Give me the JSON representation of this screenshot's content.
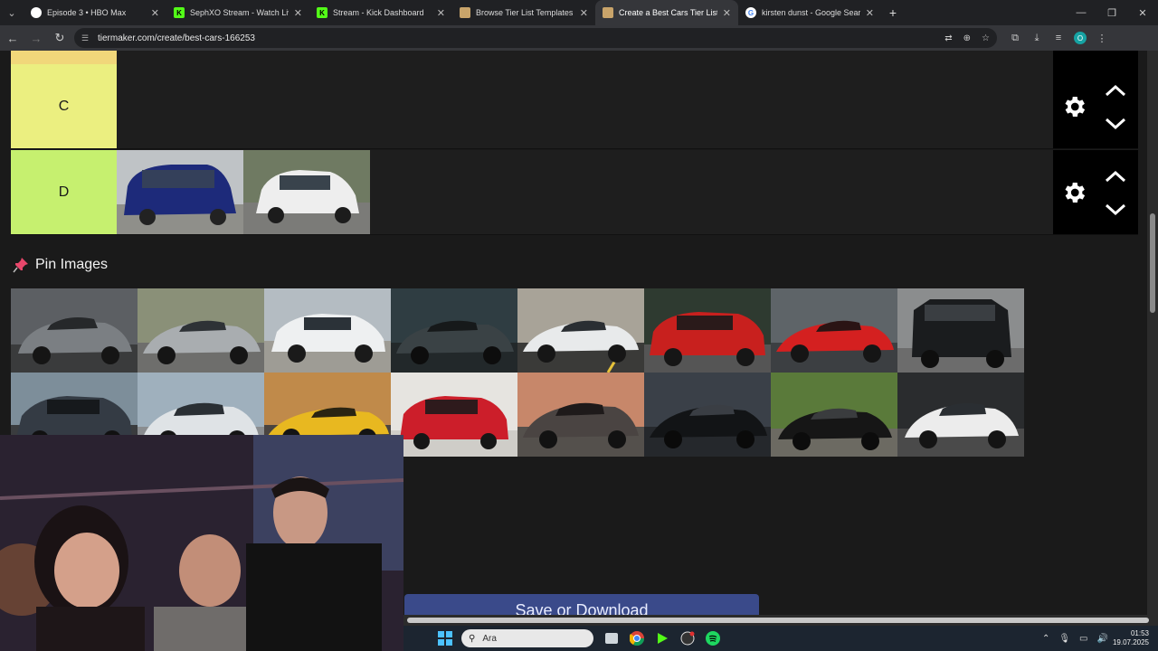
{
  "browser": {
    "tabs": [
      {
        "title": "Episode 3 • HBO Max",
        "icon": "hbo-icon",
        "color": "#ffffff"
      },
      {
        "title": "SephXO Stream - Watch Live on",
        "icon": "kick-icon",
        "color": "#53fc18"
      },
      {
        "title": "Stream - Kick Dashboard",
        "icon": "kick-icon",
        "color": "#53fc18"
      },
      {
        "title": "Browse Tier List Templates by C",
        "icon": "tiermaker-icon",
        "color": "#c9a46a"
      },
      {
        "title": "Create a Best Cars Tier List - Tie",
        "icon": "tiermaker-icon",
        "color": "#c9a46a",
        "active": true
      },
      {
        "title": "kirsten dunst - Google Search",
        "icon": "google-icon",
        "color": "#4285f4"
      }
    ],
    "url": "tiermaker.com/create/best-cars-166253",
    "profile_initial": "O"
  },
  "tiers": [
    {
      "label": "C",
      "color": "#ebef80"
    },
    {
      "label": "D",
      "color": "#c6f06f"
    }
  ],
  "pin_images": {
    "title": "Pin Images"
  },
  "save_button": {
    "label": "Save or Download"
  },
  "taskbar": {
    "search_placeholder": "Ara",
    "time": "01:53",
    "date": "19.07.2025"
  }
}
